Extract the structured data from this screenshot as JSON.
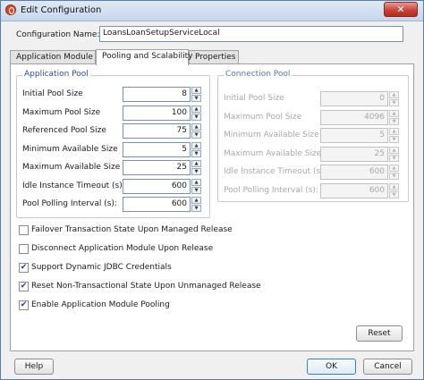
{
  "window": {
    "title": "Edit Configuration",
    "close_glyph": "✕"
  },
  "config": {
    "label": "Configuration Name:",
    "value": "LoansLoanSetupServiceLocal"
  },
  "tabs": [
    {
      "label": "Application Module"
    },
    {
      "label": "Pooling and Scalability"
    },
    {
      "label": "Properties"
    }
  ],
  "app_pool": {
    "title": "Application Pool",
    "fields": [
      {
        "label": "Initial Pool Size",
        "value": "8"
      },
      {
        "label": "Maximum Pool Size",
        "value": "100"
      },
      {
        "label": "Referenced Pool Size",
        "value": "75"
      },
      {
        "label": "Minimum Available Size",
        "value": "5"
      },
      {
        "label": "Maximum Available Size",
        "value": "25"
      },
      {
        "label": "Idle Instance Timeout (s):",
        "value": "600"
      },
      {
        "label": "Pool Polling Interval (s):",
        "value": "600"
      }
    ]
  },
  "conn_pool": {
    "title": "Connection Pool",
    "fields": [
      {
        "label": "Initial Pool Size",
        "value": "0"
      },
      {
        "label": "Maximum Pool Size",
        "value": "4096"
      },
      {
        "label": "Minimum Available Size",
        "value": "5"
      },
      {
        "label": "Maximum Available Size",
        "value": "25"
      },
      {
        "label": "Idle Instance Timeout (s):",
        "value": "600"
      },
      {
        "label": "Pool Polling Interval (s):",
        "value": "600"
      }
    ]
  },
  "checkboxes": [
    {
      "label": "Failover Transaction State Upon Managed Release",
      "checked": false,
      "mark": ""
    },
    {
      "label": "Disconnect Application Module Upon Release",
      "checked": false,
      "mark": ""
    },
    {
      "label": "Support Dynamic JDBC Credentials",
      "checked": true,
      "mark": "✔"
    },
    {
      "label": "Reset Non-Transactional State Upon Unmanaged Release",
      "checked": true,
      "mark": "✔"
    },
    {
      "label": "Enable Application Module Pooling",
      "checked": true,
      "mark": "✔"
    }
  ],
  "buttons": {
    "reset": "Reset",
    "help": "Help",
    "ok": "OK",
    "cancel": "Cancel"
  },
  "spinner_glyphs": {
    "up": "▲",
    "down": "▼"
  }
}
